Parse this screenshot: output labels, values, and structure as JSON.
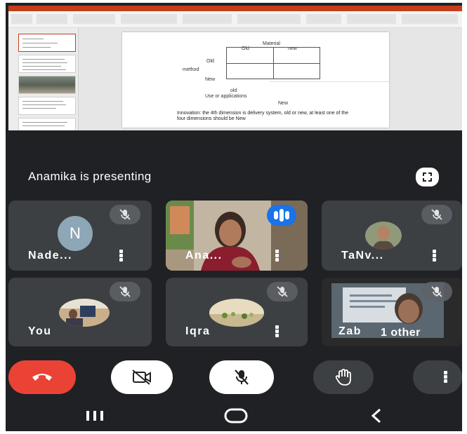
{
  "shared_slide": {
    "material_label": "Material",
    "old_col": "Old",
    "new_col": "new",
    "old_row": "Old",
    "method_label": "method",
    "new_row": "New",
    "old_below": "old",
    "use_label": "Use or applications",
    "new_below": "New",
    "caption_line1": "Innovation: the 4th dimension is delivery system, old or new, at least one of the",
    "caption_line2": "four dimensions should be New"
  },
  "presenting": {
    "text": "Anamika is presenting",
    "fullscreen_icon": "fullscreen-icon"
  },
  "participants": [
    {
      "name": "Nade...",
      "initial": "N",
      "avatar": "initial",
      "muted": true
    },
    {
      "name": "Ana...",
      "avatar": "video",
      "speaking": true
    },
    {
      "name": "TaNv...",
      "avatar": "photo",
      "muted": true
    },
    {
      "name": "You",
      "avatar": "photo",
      "muted": true
    },
    {
      "name": "Iqra",
      "avatar": "photo",
      "muted": true
    },
    {
      "name": "Zab",
      "others": "1 other",
      "avatar": "video",
      "muted": true
    }
  ],
  "controls": {
    "end_call": "end-call-icon",
    "camera": "camera-off-icon",
    "mic": "mic-off-icon",
    "hand": "raise-hand-icon",
    "more": "more-options-icon"
  },
  "colors": {
    "end_call_red": "#ea4335",
    "speaking_blue": "#1a73e8",
    "tile_bg": "#3c4043",
    "background": "#202124",
    "powerpoint_ribbon": "#c43e1c"
  }
}
